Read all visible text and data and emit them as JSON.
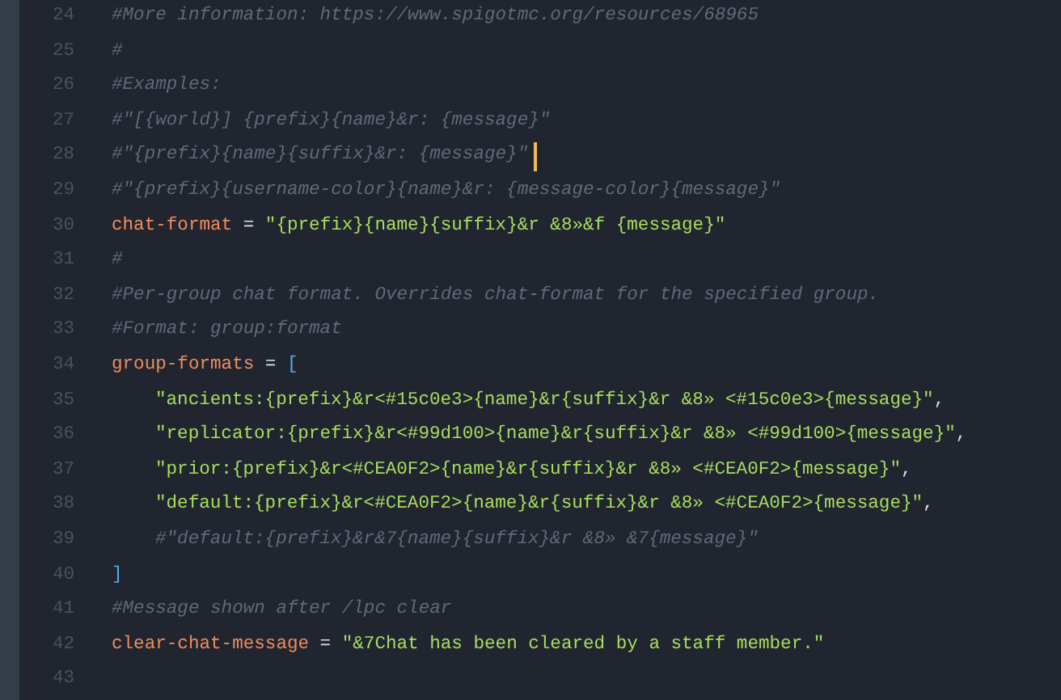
{
  "editor": {
    "lines": [
      {
        "number": "24",
        "cursor": false,
        "tokens": [
          {
            "kind": "comment",
            "text": "#More information: https://www.spigotmc.org/resources/68965"
          }
        ]
      },
      {
        "number": "25",
        "cursor": false,
        "tokens": [
          {
            "kind": "comment",
            "text": "#"
          }
        ]
      },
      {
        "number": "26",
        "cursor": false,
        "tokens": [
          {
            "kind": "comment",
            "text": "#Examples:"
          }
        ]
      },
      {
        "number": "27",
        "cursor": false,
        "tokens": [
          {
            "kind": "comment",
            "text": "#\"[{world}] {prefix}{name}&r: {message}\""
          }
        ]
      },
      {
        "number": "28",
        "cursor": true,
        "tokens": [
          {
            "kind": "comment",
            "text": "#\"{prefix}{name}{suffix}&r: {message}\""
          }
        ]
      },
      {
        "number": "29",
        "cursor": false,
        "tokens": [
          {
            "kind": "comment",
            "text": "#\"{prefix}{username-color}{name}&r: {message-color}{message}\""
          }
        ]
      },
      {
        "number": "30",
        "cursor": false,
        "tokens": [
          {
            "kind": "key",
            "text": "chat-format"
          },
          {
            "kind": "operator",
            "text": " = "
          },
          {
            "kind": "string",
            "text": "\"{prefix}{name}{suffix}&r &8»&f {message}\""
          }
        ]
      },
      {
        "number": "31",
        "cursor": false,
        "tokens": [
          {
            "kind": "comment",
            "text": "#"
          }
        ]
      },
      {
        "number": "32",
        "cursor": false,
        "tokens": [
          {
            "kind": "comment",
            "text": "#Per-group chat format. Overrides chat-format for the specified group."
          }
        ]
      },
      {
        "number": "33",
        "cursor": false,
        "tokens": [
          {
            "kind": "comment",
            "text": "#Format: group:format"
          }
        ]
      },
      {
        "number": "34",
        "cursor": false,
        "tokens": [
          {
            "kind": "key",
            "text": "group-formats"
          },
          {
            "kind": "operator",
            "text": " = "
          },
          {
            "kind": "bracket",
            "text": "["
          }
        ]
      },
      {
        "number": "35",
        "kind": "entry",
        "cursor": false,
        "tokens": [
          {
            "kind": "string",
            "text": "\"ancients:{prefix}&r<#15c0e3>{name}&r{suffix}&r &8» <#15c0e3>{message}\""
          },
          {
            "kind": "operator",
            "text": ","
          }
        ]
      },
      {
        "number": "36",
        "kind": "entry",
        "cursor": false,
        "tokens": [
          {
            "kind": "string",
            "text": "\"replicator:{prefix}&r<#99d100>{name}&r{suffix}&r &8» <#99d100>{message}\""
          },
          {
            "kind": "operator",
            "text": ","
          }
        ]
      },
      {
        "number": "37",
        "kind": "entry",
        "cursor": false,
        "tokens": [
          {
            "kind": "string",
            "text": "\"prior:{prefix}&r<#CEA0F2>{name}&r{suffix}&r &8» <#CEA0F2>{message}\""
          },
          {
            "kind": "operator",
            "text": ","
          }
        ]
      },
      {
        "number": "38",
        "kind": "entry",
        "cursor": false,
        "tokens": [
          {
            "kind": "string",
            "text": "\"default:{prefix}&r<#CEA0F2>{name}&r{suffix}&r &8» <#CEA0F2>{message}\""
          },
          {
            "kind": "operator",
            "text": ","
          }
        ]
      },
      {
        "number": "39",
        "kind": "entry",
        "cursor": false,
        "tokens": [
          {
            "kind": "comment",
            "text": "#\"default:{prefix}&r&7{name}{suffix}&r &8» &7{message}\""
          }
        ]
      },
      {
        "number": "40",
        "cursor": false,
        "tokens": [
          {
            "kind": "bracket",
            "text": "]"
          }
        ]
      },
      {
        "number": "41",
        "cursor": false,
        "tokens": [
          {
            "kind": "comment",
            "text": "#Message shown after /lpc clear"
          }
        ]
      },
      {
        "number": "42",
        "cursor": false,
        "tokens": [
          {
            "kind": "key",
            "text": "clear-chat-message"
          },
          {
            "kind": "operator",
            "text": " = "
          },
          {
            "kind": "string",
            "text": "\"&7Chat has been cleared by a staff member.\""
          }
        ]
      },
      {
        "number": "43",
        "cursor": false
      }
    ]
  }
}
